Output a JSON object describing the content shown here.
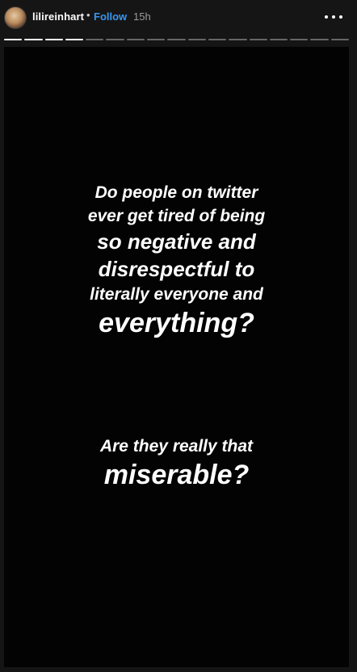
{
  "header": {
    "username": "lilireinhart",
    "separator": "•",
    "follow_label": "Follow",
    "time_ago": "15h",
    "avatar_icon": "profile-avatar",
    "more_icon": "more-horizontal-icon"
  },
  "progress": {
    "segments_total": 17,
    "segments_viewed": 4
  },
  "story": {
    "background": "#030303",
    "paragraph1": [
      "Do people on twitter",
      "ever get tired of being",
      "so negative and",
      "disrespectful to",
      "literally everyone and",
      "everything?"
    ],
    "paragraph2": [
      "Are they really that",
      "miserable?"
    ]
  },
  "colors": {
    "follow": "#3897f0",
    "text": "#ffffff",
    "time": "#9a9a9a"
  }
}
